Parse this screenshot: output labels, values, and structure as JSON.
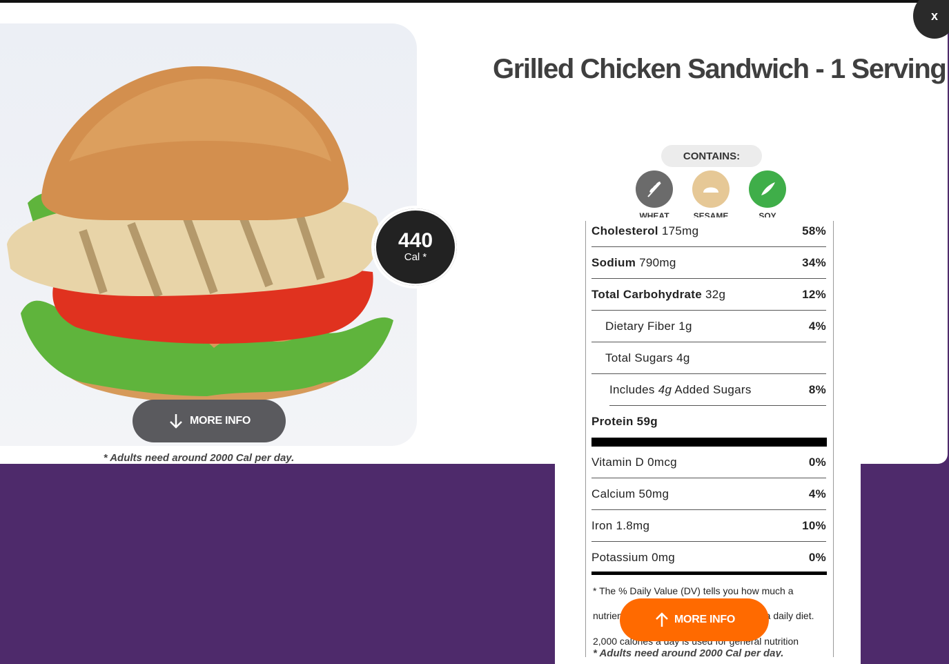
{
  "modal": {
    "close_label": "x",
    "title": "Grilled Chicken Sandwich - 1 Serving",
    "calories": "440",
    "calories_unit": "Cal *",
    "more_info_label": "MORE INFO",
    "adults_note": "* Adults need around 2000 Cal per day.",
    "contains_label": "CONTAINS:",
    "allergens": [
      {
        "label": "WHEAT",
        "icon": "wheat-icon",
        "color": "#6b6b6b"
      },
      {
        "label": "SESAME",
        "icon": "sesame-icon",
        "color": "#e6c896"
      },
      {
        "label": "SOY",
        "icon": "soy-icon",
        "color": "#3fae49"
      }
    ]
  },
  "nutrition": {
    "rows": [
      {
        "name": "Cholesterol",
        "amount": "175mg",
        "pct": "58%"
      },
      {
        "name": "Sodium",
        "amount": "790mg",
        "pct": "34%"
      },
      {
        "name": "Total Carbohydrate",
        "amount": "32g",
        "pct": "12%"
      },
      {
        "name": "Dietary Fiber 1g",
        "pct": "4%"
      },
      {
        "name": "Total Sugars 4g",
        "pct": ""
      },
      {
        "name_pre": "Includes ",
        "name_em": "4g",
        "name_post": " Added Sugars",
        "pct": "8%"
      },
      {
        "name": "Protein 59g",
        "pct": ""
      },
      {
        "name": "Vitamin D 0mcg",
        "pct": "0%"
      },
      {
        "name": "Calcium 50mg",
        "pct": "4%"
      },
      {
        "name": "Iron 1.8mg",
        "pct": "10%"
      },
      {
        "name": "Potassium 0mg",
        "pct": "0%"
      }
    ],
    "footnote_line1": "* The % Daily Value (DV) tells you how much a",
    "footnote_line2_left": "nutrien",
    "footnote_line2_right": "o a daily diet.",
    "footnote_line3": "2,000 calories a day is used for general nutrition",
    "adults_note": "* Adults need around 2000 Cal per day.",
    "more_info_label": "MORE INFO"
  },
  "colors": {
    "background": "#4e2a6b",
    "accent_orange": "#ff6a00",
    "badge_dark": "#222222"
  }
}
